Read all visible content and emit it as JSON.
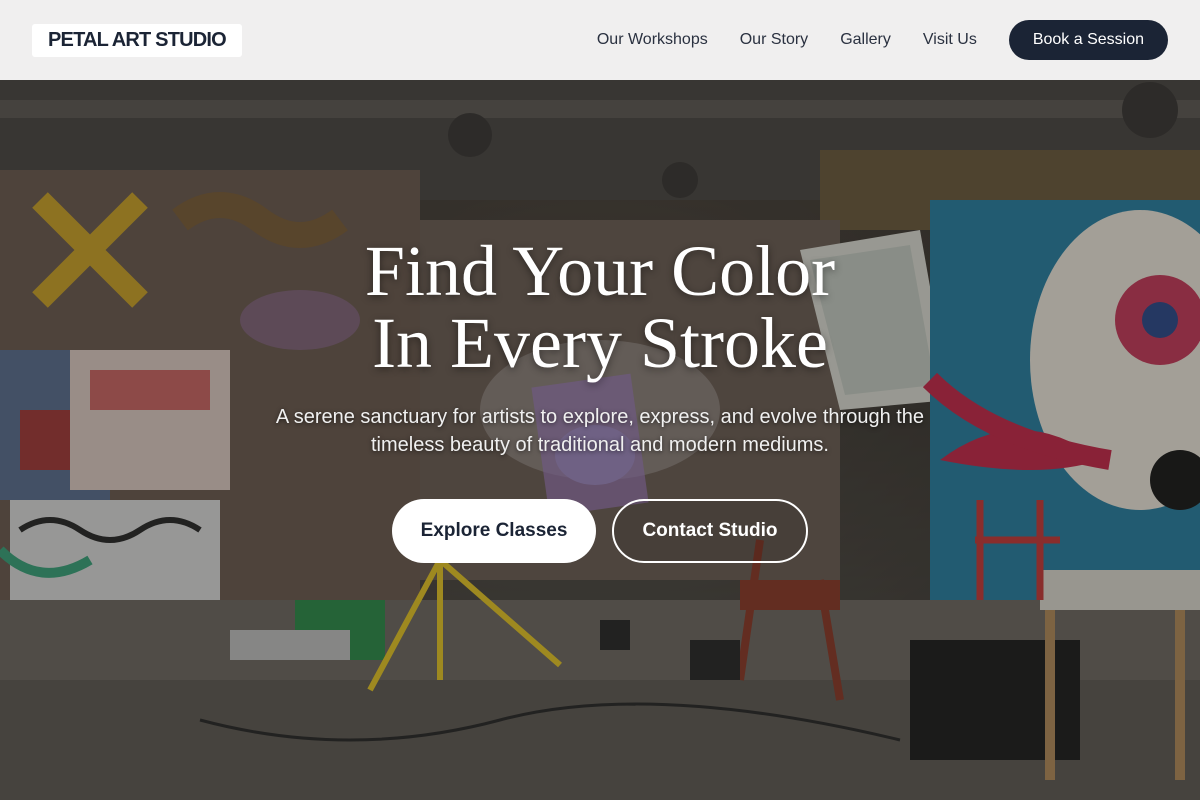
{
  "brand": {
    "name": "PETAL ART STUDIO"
  },
  "nav": {
    "links": [
      "Our Workshops",
      "Our Story",
      "Gallery",
      "Visit Us"
    ],
    "cta_label": "Book a Session"
  },
  "hero": {
    "headline_line1": "Find Your Color",
    "headline_line2": "In Every Stroke",
    "subtext": "A serene sanctuary for artists to explore, express, and evolve through the timeless beauty of traditional and modern mediums.",
    "primary_button": "Explore Classes",
    "secondary_button": "Contact Studio",
    "background_image": "graffiti-art-studio-photo"
  },
  "colors": {
    "brand_dark": "#1b2435",
    "nav_bg": "#f6f6f6",
    "hero_text": "#ffffff"
  }
}
